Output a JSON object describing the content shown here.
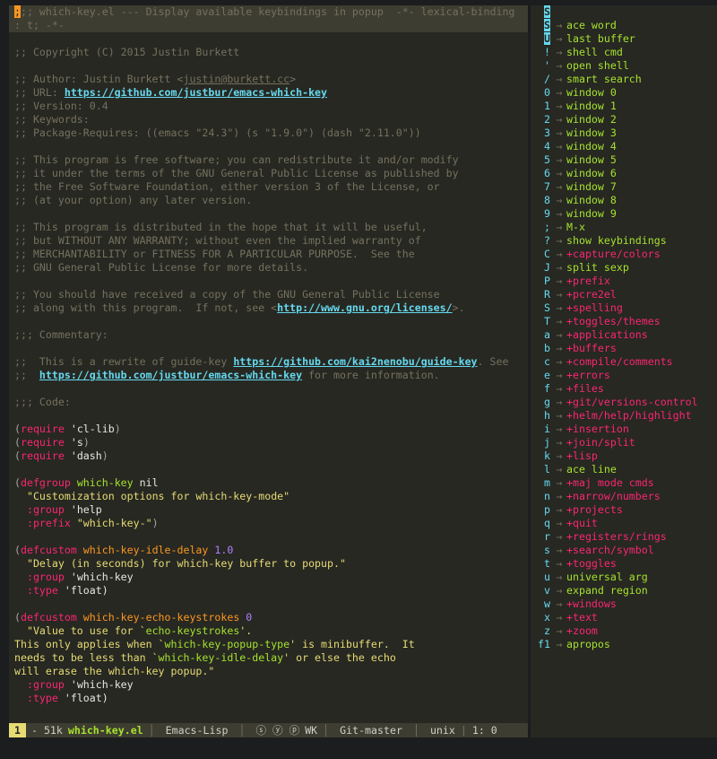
{
  "editor": {
    "header_line": ";; which-key.el --- Display available keybindings in popup  -*- lexical-binding",
    "header_line2": ": t; -*-",
    "copyright": ";; Copyright (C) 2015 Justin Burkett",
    "author_prefix": ";; Author: Justin Burkett <",
    "author_email": "justin@burkett.cc",
    "author_suffix": ">",
    "url_prefix": ";; URL: ",
    "url": "https://github.com/justbur/emacs-which-key",
    "version": ";; Version: 0.4",
    "keywords": ";; Keywords:",
    "requires": ";; Package-Requires: ((emacs \"24.3\") (s \"1.9.0\") (dash \"2.11.0\"))",
    "license1": ";; This program is free software; you can redistribute it and/or modify",
    "license2": ";; it under the terms of the GNU General Public License as published by",
    "license3": ";; the Free Software Foundation, either version 3 of the License, or",
    "license4": ";; (at your option) any later version.",
    "license5": ";; This program is distributed in the hope that it will be useful,",
    "license6": ";; but WITHOUT ANY WARRANTY; without even the implied warranty of",
    "license7": ";; MERCHANTABILITY or FITNESS FOR A PARTICULAR PURPOSE.  See the",
    "license8": ";; GNU General Public License for more details.",
    "license9": ";; You should have received a copy of the GNU General Public License",
    "license10_prefix": ";; along with this program.  If not, see <",
    "license10_url": "http://www.gnu.org/licenses/",
    "license10_suffix": ">.",
    "commentary": ";;; Commentary:",
    "rewrite_prefix": ";;  This is a rewrite of guide-key ",
    "rewrite_url": "https://github.com/kai2nenobu/guide-key",
    "rewrite_suffix": ". See",
    "rewrite2_prefix": ";;  ",
    "rewrite2_url": "https://github.com/justbur/emacs-which-key",
    "rewrite2_suffix": " for more information.",
    "code": ";;; Code:",
    "req1": "'cl-lib",
    "req2": "'s",
    "req3": "'dash",
    "require_kw": "require",
    "defgroup_kw": "defgroup",
    "defgroup_name": "which-key",
    "defgroup_nil": " nil",
    "defgroup_doc": "\"Customization options for which-key-mode\"",
    "group_kw": ":group",
    "group_val": " 'help",
    "prefix_kw": ":prefix",
    "prefix_val": "\"which-key-\"",
    "defcustom_kw": "defcustom",
    "dc1_name": "which-key-idle-delay",
    "dc1_val": "1.0",
    "dc1_doc": "\"Delay (in seconds) for which-key buffer to popup.\"",
    "wk_group": " 'which-key",
    "type_kw": ":type",
    "float_val": " 'float)",
    "dc2_name": "which-key-echo-keystrokes",
    "dc2_val": "0",
    "dc2_doc1": "\"Value to use for `",
    "dc2_doc1b": "echo-keystrokes",
    "dc2_doc1c": "'.",
    "dc2_doc2a": "This only applies when `",
    "dc2_doc2b": "which-key-popup-type",
    "dc2_doc2c": "' is minibuffer.  It",
    "dc2_doc3a": "needs to be less than `",
    "dc2_doc3b": "which-key-idle-delay",
    "dc2_doc3c": "' or else the echo",
    "dc2_doc4": "will erase the which-key popup.\""
  },
  "modeline": {
    "warn_badge": "1",
    "size": "- 51k",
    "filename": "which-key.el",
    "major_mode": "Emacs-Lisp",
    "minor_icons": "ⓢ ⓨ ⓟ",
    "wk": "WK",
    "vc": "Git-master",
    "encoding": "unix",
    "position": "1: 0"
  },
  "popup": {
    "header": "S",
    "items": [
      {
        "key": "S",
        "desc": "ace word",
        "kind": "cmd",
        "hl": true
      },
      {
        "key": "U",
        "desc": "last buffer",
        "kind": "cmd",
        "hl": true
      },
      {
        "key": "!",
        "desc": "shell cmd",
        "kind": "cmd"
      },
      {
        "key": "'",
        "desc": "open shell",
        "kind": "cmd"
      },
      {
        "key": "/",
        "desc": "smart search",
        "kind": "cmd"
      },
      {
        "key": "0",
        "desc": "window 0",
        "kind": "cmd"
      },
      {
        "key": "1",
        "desc": "window 1",
        "kind": "cmd"
      },
      {
        "key": "2",
        "desc": "window 2",
        "kind": "cmd"
      },
      {
        "key": "3",
        "desc": "window 3",
        "kind": "cmd"
      },
      {
        "key": "4",
        "desc": "window 4",
        "kind": "cmd"
      },
      {
        "key": "5",
        "desc": "window 5",
        "kind": "cmd"
      },
      {
        "key": "6",
        "desc": "window 6",
        "kind": "cmd"
      },
      {
        "key": "7",
        "desc": "window 7",
        "kind": "cmd"
      },
      {
        "key": "8",
        "desc": "window 8",
        "kind": "cmd"
      },
      {
        "key": "9",
        "desc": "window 9",
        "kind": "cmd"
      },
      {
        "key": ";",
        "desc": "M-x",
        "kind": "cmd"
      },
      {
        "key": "?",
        "desc": "show keybindings",
        "kind": "cmd"
      },
      {
        "key": "C",
        "desc": "+capture/colors",
        "kind": "grp"
      },
      {
        "key": "J",
        "desc": "split sexp",
        "kind": "cmd"
      },
      {
        "key": "P",
        "desc": "+prefix",
        "kind": "grp"
      },
      {
        "key": "R",
        "desc": "+pcre2el",
        "kind": "grp"
      },
      {
        "key": "S",
        "desc": "+spelling",
        "kind": "grp"
      },
      {
        "key": "T",
        "desc": "+toggles/themes",
        "kind": "grp"
      },
      {
        "key": "a",
        "desc": "+applications",
        "kind": "grp"
      },
      {
        "key": "b",
        "desc": "+buffers",
        "kind": "grp"
      },
      {
        "key": "c",
        "desc": "+compile/comments",
        "kind": "grp"
      },
      {
        "key": "e",
        "desc": "+errors",
        "kind": "grp"
      },
      {
        "key": "f",
        "desc": "+files",
        "kind": "grp"
      },
      {
        "key": "g",
        "desc": "+git/versions-control",
        "kind": "grp"
      },
      {
        "key": "h",
        "desc": "+helm/help/highlight",
        "kind": "grp"
      },
      {
        "key": "i",
        "desc": "+insertion",
        "kind": "grp"
      },
      {
        "key": "j",
        "desc": "+join/split",
        "kind": "grp"
      },
      {
        "key": "k",
        "desc": "+lisp",
        "kind": "grp"
      },
      {
        "key": "l",
        "desc": "ace line",
        "kind": "cmd"
      },
      {
        "key": "m",
        "desc": "+maj mode cmds",
        "kind": "grp"
      },
      {
        "key": "n",
        "desc": "+narrow/numbers",
        "kind": "grp"
      },
      {
        "key": "p",
        "desc": "+projects",
        "kind": "grp"
      },
      {
        "key": "q",
        "desc": "+quit",
        "kind": "grp"
      },
      {
        "key": "r",
        "desc": "+registers/rings",
        "kind": "grp"
      },
      {
        "key": "s",
        "desc": "+search/symbol",
        "kind": "grp"
      },
      {
        "key": "t",
        "desc": "+toggles",
        "kind": "grp"
      },
      {
        "key": "u",
        "desc": "universal arg",
        "kind": "cmd"
      },
      {
        "key": "v",
        "desc": "expand region",
        "kind": "cmd"
      },
      {
        "key": "w",
        "desc": "+windows",
        "kind": "grp"
      },
      {
        "key": "x",
        "desc": "+text",
        "kind": "grp"
      },
      {
        "key": "z",
        "desc": "+zoom",
        "kind": "grp"
      },
      {
        "key": "f1",
        "desc": "apropos",
        "kind": "cmd"
      }
    ],
    "arrow": "→"
  }
}
